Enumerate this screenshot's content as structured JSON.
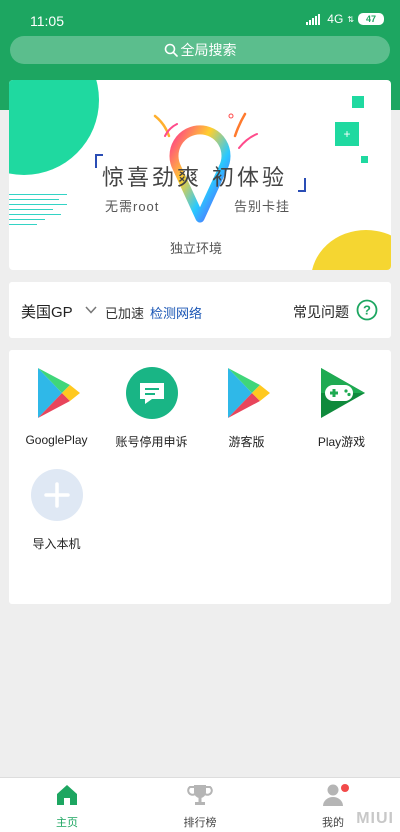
{
  "status_bar": {
    "time": "11:05",
    "network": "4G",
    "battery": "47"
  },
  "search": {
    "label": "全局搜索",
    "icon": "search-icon"
  },
  "banner": {
    "title": "惊喜劲爽  初体验",
    "subtitle_left": "无需root",
    "subtitle_right": "告别卡挂",
    "bottom_text": "独立环境",
    "plus_symbol": "+"
  },
  "region": {
    "name": "美国GP",
    "status": "已加速",
    "detect_link": "检测网络",
    "faq_label": "常见问题",
    "help_symbol": "?"
  },
  "apps": [
    {
      "label": "GooglePlay",
      "icon": "google-play-icon"
    },
    {
      "label": "账号停用申诉",
      "icon": "appeal-message-icon"
    },
    {
      "label": "游客版",
      "icon": "google-play-icon"
    },
    {
      "label": "Play游戏",
      "icon": "play-games-icon"
    },
    {
      "label": "导入本机",
      "icon": "add-icon"
    }
  ],
  "tabs": [
    {
      "label": "主页",
      "icon": "home-icon",
      "active": true
    },
    {
      "label": "排行榜",
      "icon": "trophy-icon",
      "active": false
    },
    {
      "label": "我的",
      "icon": "profile-icon",
      "active": false
    }
  ],
  "watermark": "MIUI",
  "colors": {
    "brand": "#1da661",
    "link": "#1a56b5",
    "notification": "#f24a4a"
  }
}
